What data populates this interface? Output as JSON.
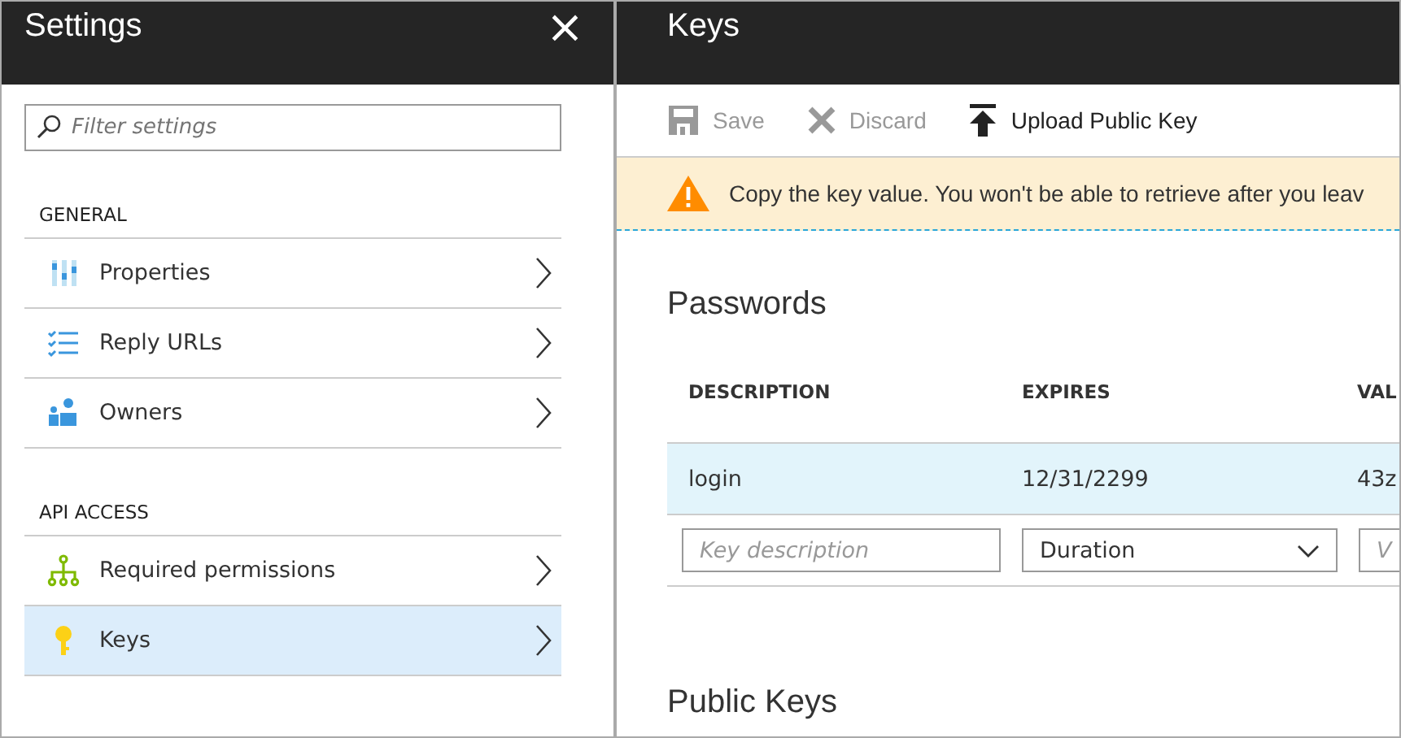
{
  "settings_panel": {
    "title": "Settings",
    "close": "×",
    "filter": {
      "placeholder": "Filter settings"
    },
    "sections": [
      {
        "heading": "GENERAL",
        "items": [
          {
            "label": "Properties",
            "kind": "properties",
            "selected": false
          },
          {
            "label": "Reply URLs",
            "kind": "list",
            "selected": false
          },
          {
            "label": "Owners",
            "kind": "people",
            "selected": false
          }
        ]
      },
      {
        "heading": "API ACCESS",
        "items": [
          {
            "label": "Required permissions",
            "kind": "hierarchy",
            "selected": false
          },
          {
            "label": "Keys",
            "kind": "key",
            "selected": true
          }
        ]
      }
    ]
  },
  "keys_panel": {
    "title": "Keys",
    "toolbar": [
      {
        "label": "Save",
        "kind": "save",
        "disabled": true
      },
      {
        "label": "Discard",
        "kind": "discard",
        "disabled": true
      },
      {
        "label": "Upload Public Key",
        "kind": "upload",
        "disabled": false
      }
    ],
    "warning": "Copy the key value. You won't be able to retrieve after you leav",
    "passwords": {
      "heading": "Passwords",
      "columns": [
        "DESCRIPTION",
        "EXPIRES",
        "VAL"
      ],
      "rows": [
        {
          "cells": [
            "login",
            "12/31/2299",
            "43z"
          ]
        }
      ],
      "new_row": {
        "description_placeholder": "Key description",
        "duration": "Duration",
        "value_placeholder": "V"
      }
    },
    "public_keys": {
      "heading": "Public Keys"
    }
  }
}
